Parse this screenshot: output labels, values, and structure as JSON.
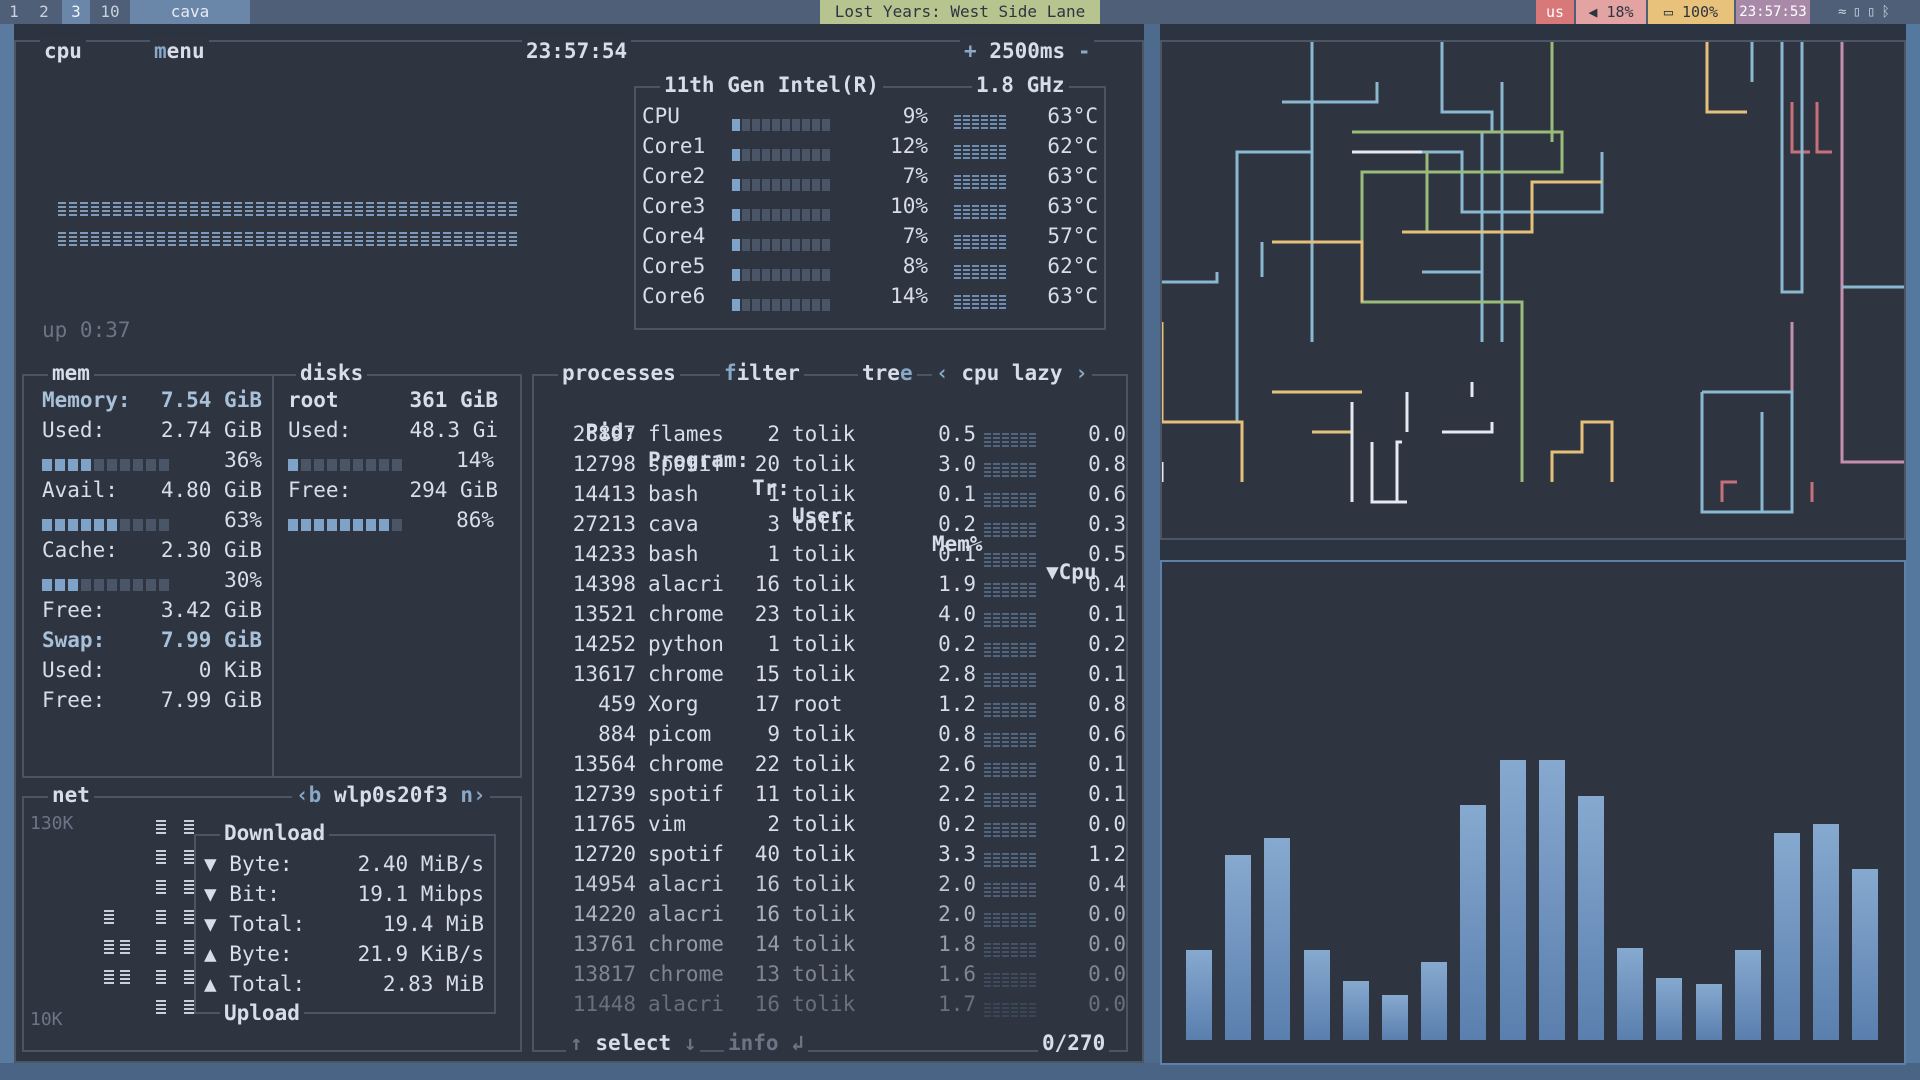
{
  "topbar": {
    "workspaces": [
      "1",
      "2",
      "3",
      "10"
    ],
    "active_workspace": "3",
    "app": "cava",
    "song": "Lost Years: West Side Lane",
    "lang": "us",
    "volume": "18%",
    "battery": "100%",
    "clock": "23:57:53"
  },
  "cpu": {
    "title": "cpu",
    "menu": "menu",
    "time": "23:57:54",
    "interval": "2500ms",
    "model": "11th Gen Intel(R)",
    "freq": "1.8 GHz",
    "uptime": "up 0:37",
    "rows": [
      {
        "name": "CPU",
        "pct": "9%",
        "temp": "63°C",
        "level": 0.09
      },
      {
        "name": "Core1",
        "pct": "12%",
        "temp": "62°C",
        "level": 0.12
      },
      {
        "name": "Core2",
        "pct": "7%",
        "temp": "63°C",
        "level": 0.07
      },
      {
        "name": "Core3",
        "pct": "10%",
        "temp": "63°C",
        "level": 0.1
      },
      {
        "name": "Core4",
        "pct": "7%",
        "temp": "57°C",
        "level": 0.07
      },
      {
        "name": "Core5",
        "pct": "8%",
        "temp": "62°C",
        "level": 0.08
      },
      {
        "name": "Core6",
        "pct": "14%",
        "temp": "63°C",
        "level": 0.14
      }
    ]
  },
  "mem": {
    "title": "mem",
    "memory_label": "Memory:",
    "memory": "7.54 GiB",
    "used_label": "Used:",
    "used": "2.74 GiB",
    "used_pct": "36%",
    "used_level": 0.36,
    "avail_label": "Avail:",
    "avail": "4.80 GiB",
    "avail_pct": "63%",
    "avail_level": 0.63,
    "cache_label": "Cache:",
    "cache": "2.30 GiB",
    "cache_pct": "30%",
    "cache_level": 0.3,
    "free_label": "Free:",
    "free": "3.42 GiB",
    "swap_label": "Swap:",
    "swap": "7.99 GiB",
    "swap_used_label": "Used:",
    "swap_used": "0 KiB",
    "swap_free_label": "Free:",
    "swap_free": "7.99 GiB"
  },
  "disks": {
    "title": "disks",
    "name": "root",
    "size": "361 GiB",
    "used_label": "Used:",
    "used": "48.3 Gi",
    "used_pct": "14%",
    "used_level": 0.14,
    "free_label": "Free:",
    "free": "294 GiB",
    "free_pct": "86%",
    "free_level": 0.86
  },
  "net": {
    "title": "net",
    "iface": "wlp0s20f3",
    "b_key": "‹b",
    "n_key": "n›",
    "scale_top": "130K",
    "scale_bottom": "10K",
    "download": "Download",
    "upload": "Upload",
    "rows": [
      {
        "arrow": "▼",
        "label": "Byte:",
        "value": "2.40 MiB/s"
      },
      {
        "arrow": "▼",
        "label": "Bit:",
        "value": "19.1 Mibps"
      },
      {
        "arrow": "▼",
        "label": "Total:",
        "value": "19.4 MiB"
      },
      {
        "arrow": "▲",
        "label": "Byte:",
        "value": "21.9 KiB/s"
      },
      {
        "arrow": "▲",
        "label": "Total:",
        "value": "2.83 MiB"
      }
    ]
  },
  "proc": {
    "title": "processes",
    "filter": "filter",
    "tree": "tree",
    "sort": "cpu lazy",
    "headers": {
      "pid": "Pid:",
      "program": "Program:",
      "tr": "Tr:",
      "user": "User:",
      "mem": "Mem%",
      "cpu": "▼Cpu"
    },
    "rows": [
      {
        "pid": "28897",
        "program": "flames",
        "tr": "2",
        "user": "tolik",
        "mem": "0.5",
        "cpu": "0.0"
      },
      {
        "pid": "12798",
        "program": "spotif",
        "tr": "20",
        "user": "tolik",
        "mem": "3.0",
        "cpu": "0.8"
      },
      {
        "pid": "14413",
        "program": "bash",
        "tr": "1",
        "user": "tolik",
        "mem": "0.1",
        "cpu": "0.6"
      },
      {
        "pid": "27213",
        "program": "cava",
        "tr": "3",
        "user": "tolik",
        "mem": "0.2",
        "cpu": "0.3"
      },
      {
        "pid": "14233",
        "program": "bash",
        "tr": "1",
        "user": "tolik",
        "mem": "0.1",
        "cpu": "0.5"
      },
      {
        "pid": "14398",
        "program": "alacri",
        "tr": "16",
        "user": "tolik",
        "mem": "1.9",
        "cpu": "0.4"
      },
      {
        "pid": "13521",
        "program": "chrome",
        "tr": "23",
        "user": "tolik",
        "mem": "4.0",
        "cpu": "0.1"
      },
      {
        "pid": "14252",
        "program": "python",
        "tr": "1",
        "user": "tolik",
        "mem": "0.2",
        "cpu": "0.2"
      },
      {
        "pid": "13617",
        "program": "chrome",
        "tr": "15",
        "user": "tolik",
        "mem": "2.8",
        "cpu": "0.1"
      },
      {
        "pid": "459",
        "program": "Xorg",
        "tr": "17",
        "user": "root",
        "mem": "1.2",
        "cpu": "0.8"
      },
      {
        "pid": "884",
        "program": "picom",
        "tr": "9",
        "user": "tolik",
        "mem": "0.8",
        "cpu": "0.6"
      },
      {
        "pid": "13564",
        "program": "chrome",
        "tr": "22",
        "user": "tolik",
        "mem": "2.6",
        "cpu": "0.1"
      },
      {
        "pid": "12739",
        "program": "spotif",
        "tr": "11",
        "user": "tolik",
        "mem": "2.2",
        "cpu": "0.1"
      },
      {
        "pid": "11765",
        "program": "vim",
        "tr": "2",
        "user": "tolik",
        "mem": "0.2",
        "cpu": "0.0"
      },
      {
        "pid": "12720",
        "program": "spotif",
        "tr": "40",
        "user": "tolik",
        "mem": "3.3",
        "cpu": "1.2"
      },
      {
        "pid": "14954",
        "program": "alacri",
        "tr": "16",
        "user": "tolik",
        "mem": "2.0",
        "cpu": "0.4"
      },
      {
        "pid": "14220",
        "program": "alacri",
        "tr": "16",
        "user": "tolik",
        "mem": "2.0",
        "cpu": "0.0"
      },
      {
        "pid": "13761",
        "program": "chrome",
        "tr": "14",
        "user": "tolik",
        "mem": "1.8",
        "cpu": "0.0"
      },
      {
        "pid": "13817",
        "program": "chrome",
        "tr": "13",
        "user": "tolik",
        "mem": "1.6",
        "cpu": "0.0"
      },
      {
        "pid": "11448",
        "program": "alacri",
        "tr": "16",
        "user": "tolik",
        "mem": "1.7",
        "cpu": "0.0"
      }
    ],
    "select": "select",
    "info": "info",
    "count": "0/270"
  },
  "cava_levels": [
    0.32,
    0.66,
    0.72,
    0.32,
    0.21,
    0.16,
    0.28,
    0.84,
    1.0,
    1.0,
    0.87,
    0.33,
    0.22,
    0.2,
    0.32,
    0.74,
    0.77,
    0.61
  ],
  "colors": {
    "accent": "#88a8c8",
    "bar": "#7ea2c8",
    "cava": "#6f93bf",
    "pipe_blue": "#8ab8d0",
    "pipe_green": "#9bbb7a",
    "pipe_yellow": "#e5c07b",
    "pipe_white": "#e5e9f0",
    "pipe_red": "#c8707a",
    "pipe_pink": "#c490b0"
  }
}
